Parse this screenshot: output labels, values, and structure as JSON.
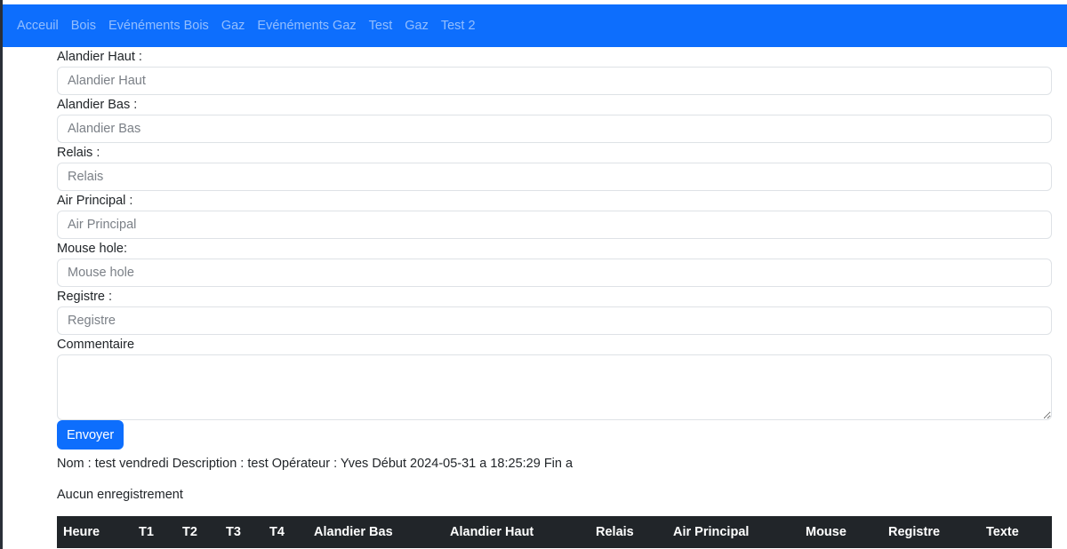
{
  "nav": {
    "items": [
      {
        "label": "Acceuil"
      },
      {
        "label": "Bois"
      },
      {
        "label": "Evénéments Bois"
      },
      {
        "label": "Gaz"
      },
      {
        "label": "Evénéments Gaz"
      },
      {
        "label": "Test"
      },
      {
        "label": "Gaz"
      },
      {
        "label": "Test 2"
      }
    ]
  },
  "form": {
    "fields": [
      {
        "label": "Alandier Haut :",
        "placeholder": "Alandier Haut",
        "value": ""
      },
      {
        "label": "Alandier Bas :",
        "placeholder": "Alandier Bas",
        "value": ""
      },
      {
        "label": "Relais :",
        "placeholder": "Relais",
        "value": ""
      },
      {
        "label": "Air Principal :",
        "placeholder": "Air Principal",
        "value": ""
      },
      {
        "label": "Mouse hole:",
        "placeholder": "Mouse hole",
        "value": ""
      },
      {
        "label": "Registre :",
        "placeholder": "Registre",
        "value": ""
      }
    ],
    "comment_label": "Commentaire",
    "comment_value": "",
    "submit_label": "Envoyer"
  },
  "info_line": "Nom : test vendredi Description : test Opérateur : Yves Début 2024-05-31 a 18:25:29 Fin a",
  "empty_message": "Aucun enregistrement",
  "table": {
    "headers": [
      "Heure",
      "T1",
      "T2",
      "T3",
      "T4",
      "Alandier Bas",
      "Alandier Haut",
      "Relais",
      "Air Principal",
      "Mouse",
      "Registre",
      "Texte"
    ]
  },
  "colors": {
    "navbar": "#0d6efd",
    "button": "#0d6efd",
    "table_header": "#212529"
  }
}
